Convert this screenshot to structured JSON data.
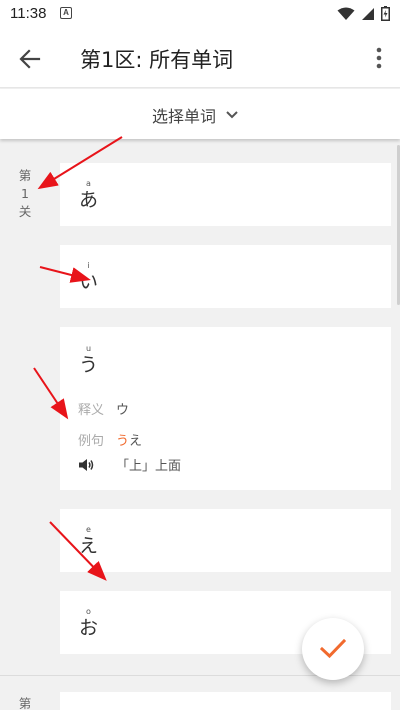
{
  "status_bar": {
    "time": "11:38",
    "notification_letter": "A"
  },
  "app_bar": {
    "title": "第1区: 所有单词"
  },
  "selector": {
    "label": "选择单词"
  },
  "sections": [
    {
      "label_chars": [
        "第",
        "1",
        "关"
      ]
    },
    {
      "label_chars": [
        "第"
      ]
    }
  ],
  "cards": [
    {
      "romaji": "a",
      "kana": "あ"
    },
    {
      "romaji": "i",
      "kana": "い"
    },
    {
      "romaji": "u",
      "kana": "う",
      "meaning_label": "释义",
      "meaning_value": "ウ",
      "example_label": "例句",
      "example_highlight": "う",
      "example_rest": "え",
      "example_translation": "「上」上面"
    },
    {
      "romaji": "e",
      "kana": "え"
    },
    {
      "romaji": "o",
      "kana": "お"
    }
  ],
  "colors": {
    "accent": "#f16a2e",
    "annotation_arrow": "#e8141a"
  },
  "icons": {
    "back": "arrow-left-icon",
    "more": "more-vertical-icon",
    "dropdown": "chevron-down-icon",
    "speaker": "speaker-icon",
    "confirm": "check-icon"
  }
}
